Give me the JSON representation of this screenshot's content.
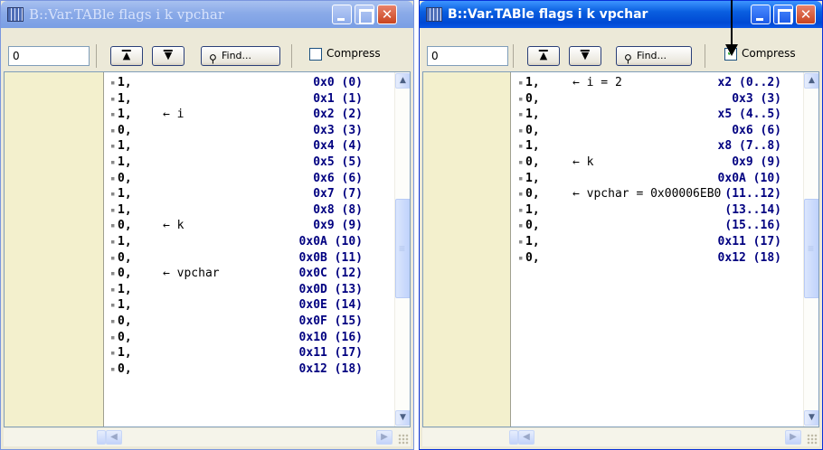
{
  "left_window": {
    "title": "B::Var.TABle flags i k vpchar",
    "address_value": "0",
    "find_label": "Find...",
    "compress_label": "Compress",
    "compress_checked": false,
    "rows": [
      {
        "addr": "0x0 (0)",
        "val": "1,",
        "note": ""
      },
      {
        "addr": "0x1 (1)",
        "val": "1,",
        "note": ""
      },
      {
        "addr": "0x2 (2)",
        "val": "1,",
        "note": "← i"
      },
      {
        "addr": "0x3 (3)",
        "val": "0,",
        "note": ""
      },
      {
        "addr": "0x4 (4)",
        "val": "1,",
        "note": ""
      },
      {
        "addr": "0x5 (5)",
        "val": "1,",
        "note": ""
      },
      {
        "addr": "0x6 (6)",
        "val": "0,",
        "note": ""
      },
      {
        "addr": "0x7 (7)",
        "val": "1,",
        "note": ""
      },
      {
        "addr": "0x8 (8)",
        "val": "1,",
        "note": ""
      },
      {
        "addr": "0x9 (9)",
        "val": "0,",
        "note": "← k"
      },
      {
        "addr": "0x0A (10)",
        "val": "1,",
        "note": ""
      },
      {
        "addr": "0x0B (11)",
        "val": "0,",
        "note": ""
      },
      {
        "addr": "0x0C (12)",
        "val": "0,",
        "note": "← vpchar"
      },
      {
        "addr": "0x0D (13)",
        "val": "1,",
        "note": ""
      },
      {
        "addr": "0x0E (14)",
        "val": "1,",
        "note": ""
      },
      {
        "addr": "0x0F (15)",
        "val": "0,",
        "note": ""
      },
      {
        "addr": "0x10 (16)",
        "val": "0,",
        "note": ""
      },
      {
        "addr": "0x11 (17)",
        "val": "1,",
        "note": ""
      },
      {
        "addr": "0x12 (18)",
        "val": "0,",
        "note": ""
      }
    ]
  },
  "right_window": {
    "title": "B::Var.TABle flags i k vpchar",
    "address_value": "0",
    "find_label": "Find...",
    "compress_label": "Compress",
    "compress_checked": true,
    "rows": [
      {
        "addr": "x2 (0..2)",
        "val": "1,",
        "note": "← i = 2"
      },
      {
        "addr": "0x3 (3)",
        "val": "0,",
        "note": ""
      },
      {
        "addr": "x5 (4..5)",
        "val": "1,",
        "note": ""
      },
      {
        "addr": "0x6 (6)",
        "val": "0,",
        "note": ""
      },
      {
        "addr": "x8 (7..8)",
        "val": "1,",
        "note": ""
      },
      {
        "addr": "0x9 (9)",
        "val": "0,",
        "note": "← k"
      },
      {
        "addr": "0x0A (10)",
        "val": "1,",
        "note": ""
      },
      {
        "addr": "(11..12)",
        "val": "0,",
        "note": "← vpchar = 0x00006EB0"
      },
      {
        "addr": "(13..14)",
        "val": "1,",
        "note": ""
      },
      {
        "addr": "(15..16)",
        "val": "0,",
        "note": ""
      },
      {
        "addr": "0x11 (17)",
        "val": "1,",
        "note": ""
      },
      {
        "addr": "0x12 (18)",
        "val": "0,",
        "note": ""
      }
    ]
  },
  "icons": {
    "window_icon": "grid-window-icon",
    "scroll_top": "scroll-top-icon",
    "scroll_bottom": "scroll-bottom-icon",
    "find": "binoculars-icon",
    "minimize": "minimize-icon",
    "maximize": "maximize-icon",
    "close": "close-icon"
  },
  "colors": {
    "address_text": "#000080",
    "address_column_bg": "#f3f0cd",
    "active_title": "#0a5fe0",
    "inactive_title": "#8aaae8"
  }
}
